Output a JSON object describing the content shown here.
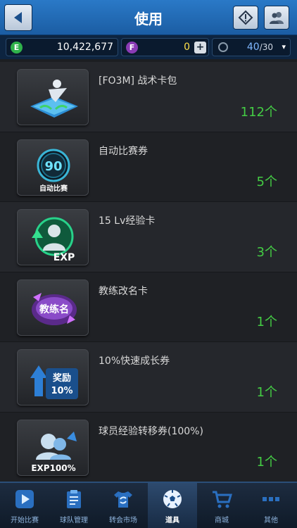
{
  "header": {
    "title": "使用"
  },
  "currency": {
    "e_icon": "E",
    "e_value": "10,422,677",
    "f_icon": "F",
    "f_value": "0",
    "f_plus": "+",
    "energy_value": "40",
    "energy_max": "/30",
    "energy_dropdown": "▾"
  },
  "items": [
    {
      "name": "[FO3M] 战术卡包",
      "count": "112个",
      "icon": "tactics-pack-icon"
    },
    {
      "name": "自动比赛券",
      "count": "5个",
      "icon": "auto-match-ticket-icon",
      "badge": "90",
      "caption": "自动比赛"
    },
    {
      "name": "15 Lv经验卡",
      "count": "3个",
      "icon": "exp-card-icon",
      "caption": "EXP"
    },
    {
      "name": "教练改名卡",
      "count": "1个",
      "icon": "coach-rename-icon",
      "caption": "教练名"
    },
    {
      "name": "10%快速成长券",
      "count": "1个",
      "icon": "growth-ticket-icon",
      "caption": "奖励",
      "caption2": "10%"
    },
    {
      "name": "球员经验转移券(100%)",
      "count": "1个",
      "icon": "exp-transfer-icon",
      "caption": "EXP100%"
    }
  ],
  "nav": [
    {
      "label": "开始比赛",
      "icon": "play-icon"
    },
    {
      "label": "球队管理",
      "icon": "clipboard-icon"
    },
    {
      "label": "转会市场",
      "icon": "transfer-shirt-icon"
    },
    {
      "label": "道具",
      "icon": "ball-icon"
    },
    {
      "label": "商城",
      "icon": "cart-icon"
    },
    {
      "label": "其他",
      "icon": "more-icon"
    }
  ]
}
